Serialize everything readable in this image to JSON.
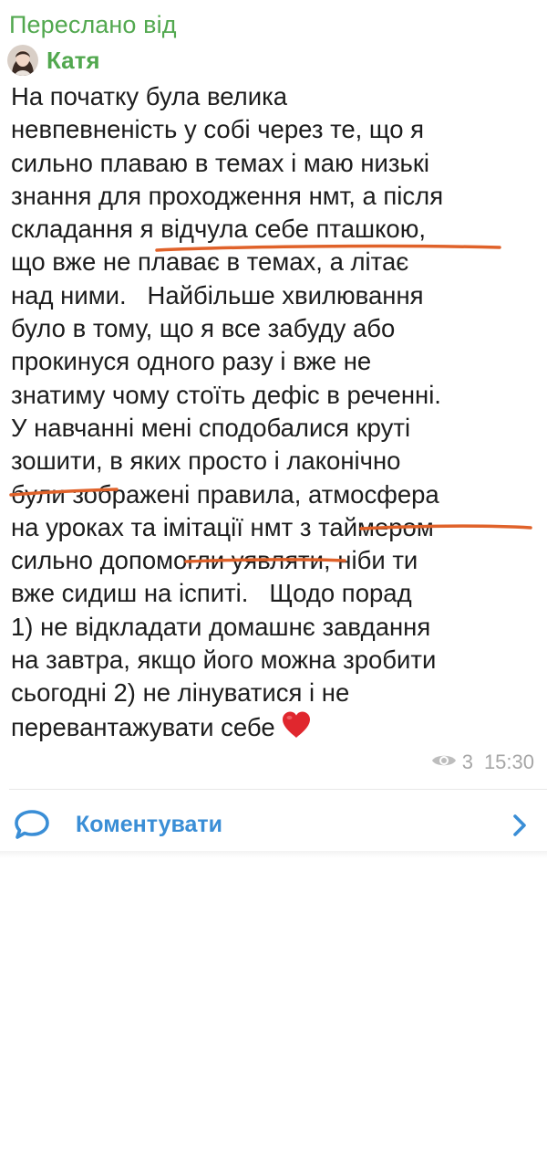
{
  "post": {
    "forwarded_from_label": "Переслано від",
    "author_name": "Катя",
    "lines": [
      "На початку була велика",
      "невпевненість у собі через те, що я",
      "сильно плаваю в темах і маю низькі",
      "знання для проходження нмт, а після",
      "складання я відчула себе пташкою,",
      "що вже не плаває в темах, а літає",
      "над ними.   Найбільше хвилювання",
      "було в тому, що я все забуду або",
      "прокинуся одного разу і вже не",
      "знатиму чому стоїть дефіс в реченні.",
      "У навчанні мені сподобалися круті",
      "зошити, в яких просто і лаконічно",
      "були зображені правила, атмосфера",
      "на уроках та імітації нмт з таймером",
      "сильно допомогли уявляти, ніби ти",
      "вже сидиш на іспиті.   Щодо порад",
      "1) не відкладати домашнє завдання",
      "на завтра, якщо його можна зробити",
      "сьогодні 2) не лінуватися і не",
      "перевантажувати себе"
    ],
    "views": "3",
    "time": "15:30"
  },
  "comments": {
    "label": "Коментувати"
  },
  "colors": {
    "accent_green": "#52a84f",
    "link_blue": "#3a8ed6",
    "underline_orange": "#e0622a",
    "heart_red": "#e0272e"
  },
  "icons": {
    "avatar": "avatar",
    "views": "eye-icon",
    "comment": "comment-bubble-icon",
    "chevron": "chevron-right-icon",
    "emoji": "red-heart-emoji"
  }
}
